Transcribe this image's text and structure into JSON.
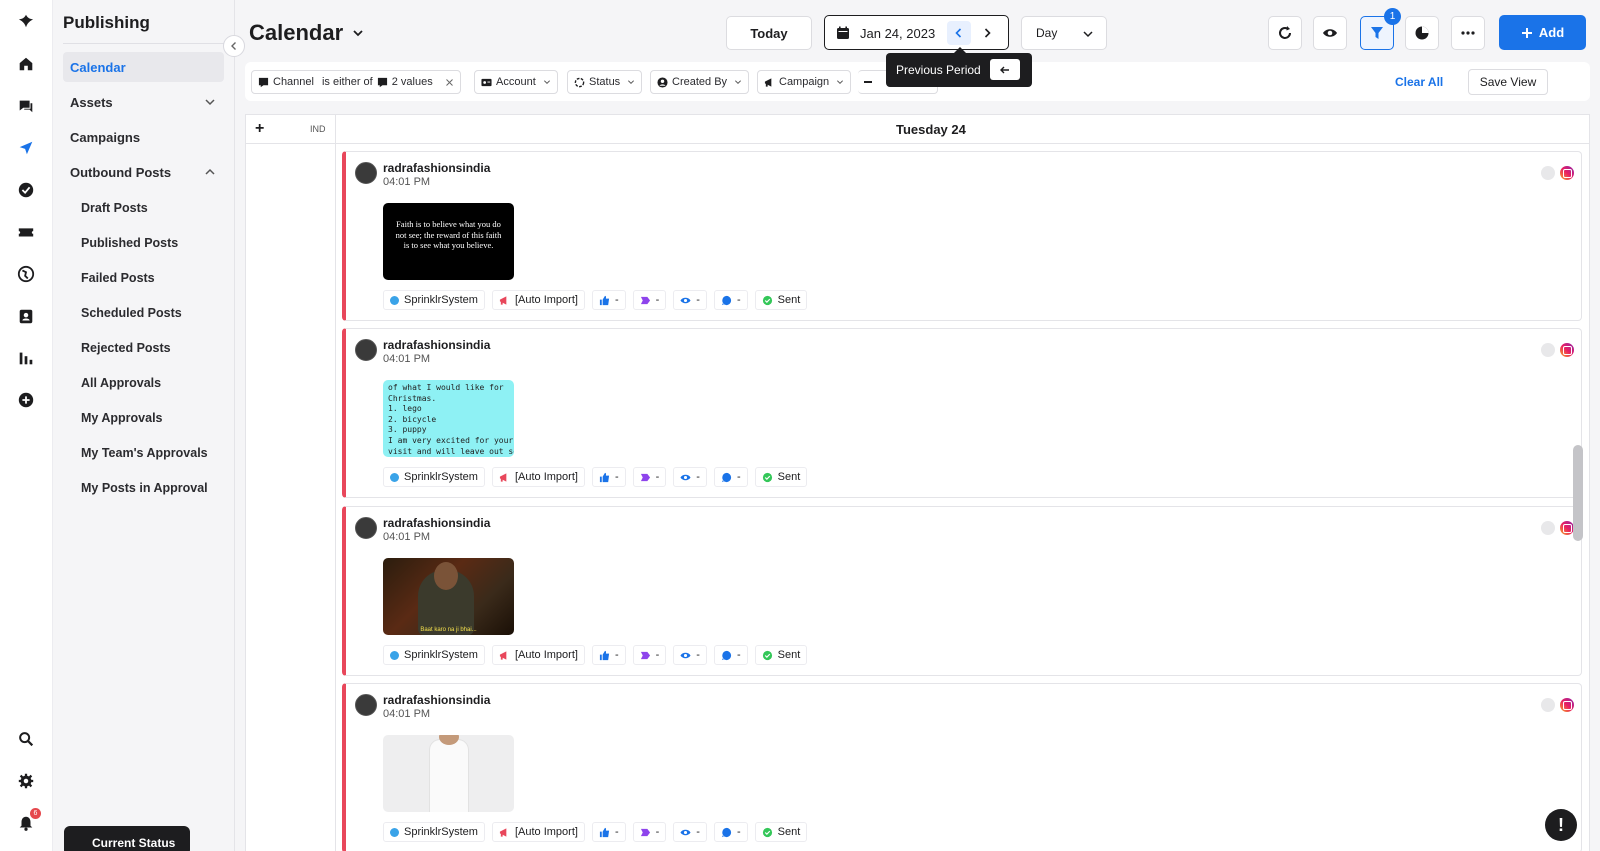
{
  "rail": {
    "items": [
      "logo-icon",
      "home-icon",
      "chat-icon",
      "send-icon",
      "check-circle-icon",
      "ticket-icon",
      "globe-icon",
      "contact-card-icon",
      "bar-chart-icon",
      "plus-circle-icon"
    ],
    "bottom": [
      "search-icon",
      "gear-icon",
      "bell-icon"
    ],
    "notification_count": "6"
  },
  "sidebar": {
    "title": "Publishing",
    "items": [
      {
        "label": "Calendar",
        "active": true
      },
      {
        "label": "Assets"
      },
      {
        "label": "Campaigns"
      },
      {
        "label": "Outbound Posts"
      }
    ],
    "sub_items": [
      "Draft Posts",
      "Published Posts",
      "Failed Posts",
      "Scheduled Posts",
      "Rejected Posts",
      "All Approvals",
      "My Approvals",
      "My Team's Approvals",
      "My Posts in Approval"
    ],
    "current_status": "Current Status"
  },
  "header": {
    "title": "Calendar",
    "today": "Today",
    "date": "Jan 24, 2023",
    "view": "Day",
    "filter_count": "1",
    "add": "Add",
    "tooltip": "Previous Period"
  },
  "filters": {
    "channel_label": "Channel",
    "channel_op": "is either of",
    "channel_values": "2 values",
    "chips": [
      "Account",
      "Status",
      "Created By",
      "Campaign"
    ],
    "clear_all": "Clear All",
    "save_view": "Save View"
  },
  "calendar": {
    "plus": "+",
    "tz": "IND",
    "day": "Tuesday 24"
  },
  "posts": [
    {
      "handle": "radrafashionsindia",
      "time": "04:01 PM",
      "image_text": "Faith is to believe what you do not see; the reward of this faith is to see what you believe."
    },
    {
      "handle": "radrafashionsindia",
      "time": "04:01 PM",
      "image_text": "of what I would like for\nChristmas.\n1. lego\n2. bicycle\n3. puppy\nI am very excited for your\nvisit and will leave out some"
    },
    {
      "handle": "radrafashionsindia",
      "time": "04:01 PM",
      "image_text": "Baat karo na ji bhai..."
    },
    {
      "handle": "radrafashionsindia",
      "time": "04:01 PM",
      "image_text": ""
    }
  ],
  "post_tags": {
    "user": "SprinklrSystem",
    "campaign": "[Auto Import]",
    "likes": "-",
    "shares": "-",
    "views": "-",
    "comments": "-",
    "status": "Sent"
  },
  "colors": {
    "accent": "#1a73e8",
    "post_border": "#e8475b",
    "sent": "#34c759"
  }
}
